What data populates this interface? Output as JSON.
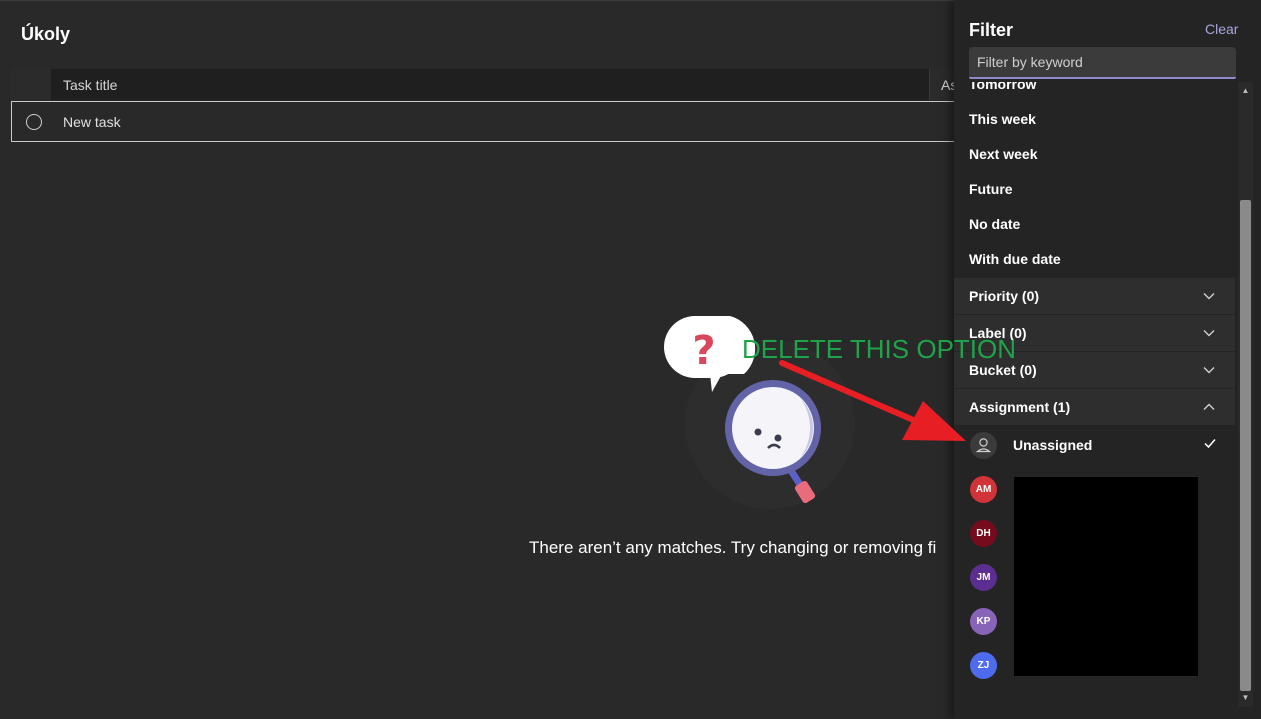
{
  "page": {
    "title": "Úkoly"
  },
  "table": {
    "col_title": "Task title",
    "col_assign": "As",
    "new_task_label": "New task"
  },
  "empty_state": {
    "message": "There aren’t any matches. Try changing or removing fi"
  },
  "filter": {
    "title": "Filter",
    "clear_label": "Clear",
    "keyword_placeholder": "Filter by keyword",
    "due_options": [
      "Tomorrow",
      "This week",
      "Next week",
      "Future",
      "No date",
      "With due date"
    ],
    "sections": [
      {
        "label": "Priority (0)",
        "expanded": false
      },
      {
        "label": "Label (0)",
        "expanded": false
      },
      {
        "label": "Bucket (0)",
        "expanded": false
      },
      {
        "label": "Assignment (1)",
        "expanded": true
      }
    ],
    "assignment": {
      "unassigned_label": "Unassigned",
      "unassigned_checked": true,
      "people": [
        {
          "initials": "AM",
          "color": "#d13438"
        },
        {
          "initials": "DH",
          "color": "#750b1c"
        },
        {
          "initials": "JM",
          "color": "#5c2e91"
        },
        {
          "initials": "KP",
          "color": "#8764b8"
        },
        {
          "initials": "ZJ",
          "color": "#4f6bed"
        }
      ]
    }
  },
  "annotation": {
    "text": "DELETE THIS OPTION",
    "color": "#1fa34a",
    "arrow_color": "#e81e25"
  },
  "icons": {
    "task_circle": "circle-outline-icon",
    "chevron_down": "chevron-down-icon",
    "chevron_up": "chevron-up-icon",
    "check": "checkmark-icon",
    "person": "person-icon"
  }
}
